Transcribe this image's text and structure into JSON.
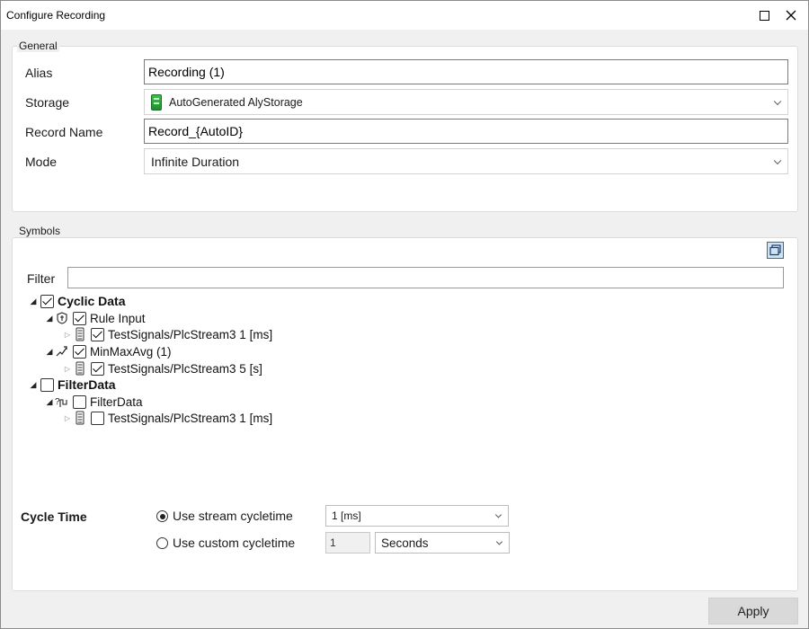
{
  "window": {
    "title": "Configure Recording"
  },
  "general": {
    "legend": "General",
    "alias_label": "Alias",
    "alias_value": "Recording (1)",
    "storage_label": "Storage",
    "storage_value": "AutoGenerated AlyStorage",
    "record_name_label": "Record Name",
    "record_name_value": "Record_{AutoID}",
    "mode_label": "Mode",
    "mode_value": "Infinite Duration"
  },
  "symbols": {
    "legend": "Symbols",
    "filter_label": "Filter",
    "filter_value": "",
    "tree": [
      {
        "label": "Cyclic Data",
        "checked": true
      },
      {
        "label": "Rule Input",
        "checked": true
      },
      {
        "label": "TestSignals/PlcStream3  1 [ms]",
        "checked": true
      },
      {
        "label": "MinMaxAvg (1)",
        "checked": true
      },
      {
        "label": "TestSignals/PlcStream3  5 [s]",
        "checked": true
      },
      {
        "label": "FilterData",
        "checked": false
      },
      {
        "label": "FilterData",
        "checked": false
      },
      {
        "label": "TestSignals/PlcStream3  1 [ms]",
        "checked": false
      }
    ]
  },
  "cycle_time": {
    "label": "Cycle Time",
    "use_stream_label": "Use stream cycletime",
    "use_stream_selected": true,
    "stream_value": "1 [ms]",
    "use_custom_label": "Use custom cycletime",
    "custom_value": "1",
    "custom_unit": "Seconds"
  },
  "footer": {
    "apply_label": "Apply"
  },
  "colors": {
    "storage_icon": "#2bb33f",
    "collapse_button": "#2f6fb0"
  }
}
